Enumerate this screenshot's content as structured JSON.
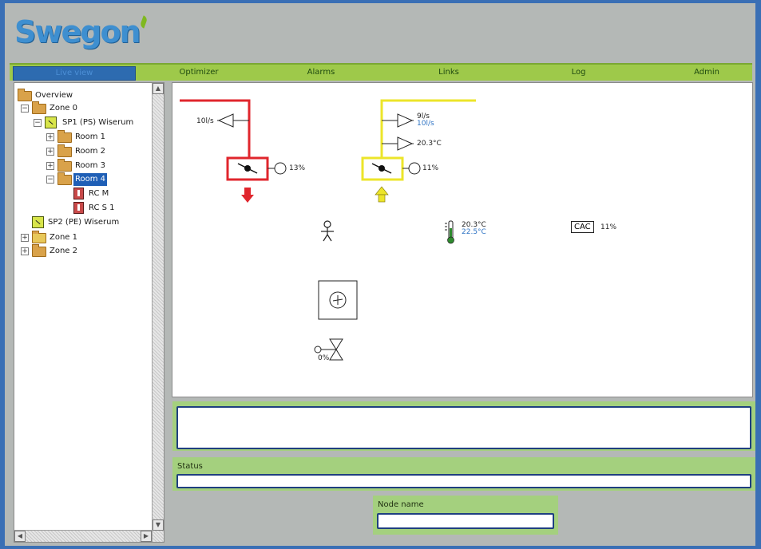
{
  "brand": {
    "logo_text": "Swegon",
    "accent": "#3e8fd0",
    "nav_bg": "#9ec94a"
  },
  "nav": {
    "items": [
      "Live view",
      "Optimizer",
      "Alarms",
      "Links",
      "Log",
      "Admin"
    ],
    "active": "Live view"
  },
  "tree": {
    "overview": "Overview",
    "zone0": "Zone 0",
    "sp1": "SP1 (PS) Wiserum",
    "room1": "Room 1",
    "room2": "Room 2",
    "room3": "Room 3",
    "room4": "Room 4",
    "rcm": "RC M",
    "rcs1": "RC S 1",
    "sp2": "SP2 (PE) Wiserum",
    "zone1": "Zone 1",
    "zone2": "Zone 2"
  },
  "diagram": {
    "supply_flow": "10l/s",
    "supply_damper": "13%",
    "extract_flow": "9l/s",
    "extract_flow_setpoint": "10l/s",
    "extract_temp": "20.3°C",
    "extract_damper": "11%",
    "room_temp": "20.3°C",
    "room_temp_setpoint": "22.5°C",
    "cac_label": "CAC",
    "cac_value": "11%",
    "valve_value": "0%",
    "supply_color": "#e0262d",
    "extract_color": "#ece52a"
  },
  "status": {
    "label": "Status",
    "value": ""
  },
  "node": {
    "label": "Node name",
    "value": ""
  }
}
